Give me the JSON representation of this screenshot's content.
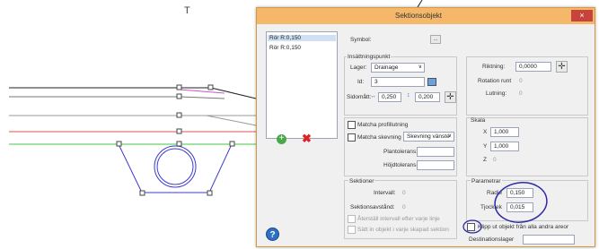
{
  "dialog": {
    "title": "Sektionsobjekt",
    "close_glyph": "×",
    "list_items": [
      "Rör R:0,150",
      "Rör R:0,150"
    ],
    "symbol_label": "Symbol:",
    "symbol_btn": "...",
    "insertion": {
      "title": "Insättningspunkt",
      "layer_label": "Lager:",
      "layer_value": "Drainage",
      "id_label": "Id:",
      "id_value": "3",
      "offset_label": "Sidomått:",
      "offset_value": "0,250",
      "offset_value2": "0,200"
    },
    "direction": {
      "label": "Riktning:",
      "value": "0,0000",
      "rotation_label": "Rotation runt",
      "rotation_value": "0",
      "slope_label": "Lutning:",
      "slope_value": "0"
    },
    "match": {
      "profile_label": "Matcha profillutning",
      "skew_label": "Matcha skevning",
      "skew_value": "Skevning vänste",
      "plane_label": "Plantolerans:",
      "height_label": "Höjdtolerans:"
    },
    "scale": {
      "title": "Skala",
      "x_label": "X",
      "x_value": "1,000",
      "y_label": "Y",
      "y_value": "1,000",
      "z_label": "Z",
      "z_value": "0"
    },
    "sections": {
      "title": "Sektioner",
      "interval_label": "Intervall:",
      "interval_value": "0",
      "spacing_label": "Sektionsavstånd:",
      "spacing_value": "0",
      "reset_label": "Återställ intervall efter varje linje",
      "insert_label": "Sätt in objekt i varje skapad sektion"
    },
    "params": {
      "title": "Parametrar",
      "radius_label": "Radie",
      "radius_value": "0,150",
      "thickness_label": "Tjocklek",
      "thickness_value": "0,015"
    },
    "cut_label": "Klipp ut objekt från alla andra areor",
    "dest_label": "Destinationslager",
    "help_glyph": "?"
  },
  "cad": {
    "cursor_glyph": "T"
  },
  "colors": {
    "title_bar": "#f5b86a",
    "close": "#c7443b",
    "annotation": "#2a2aa8"
  }
}
